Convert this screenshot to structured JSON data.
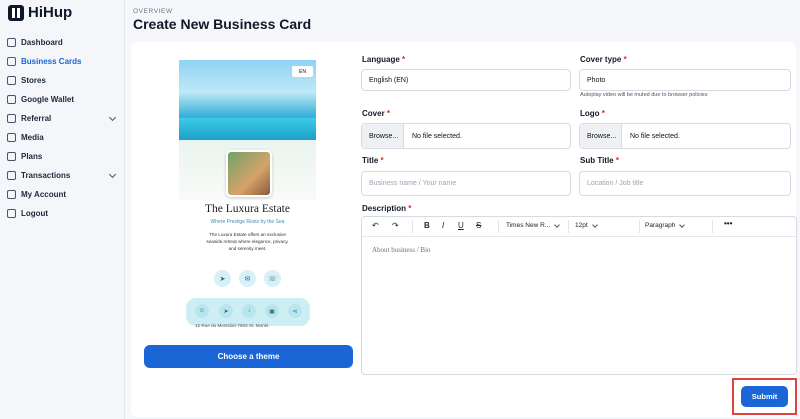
{
  "app": {
    "name": "HiHup"
  },
  "sidebar": {
    "items": [
      {
        "label": "Dashboard",
        "icon": "home-icon"
      },
      {
        "label": "Business Cards",
        "icon": "card-icon",
        "active": true
      },
      {
        "label": "Stores",
        "icon": "store-icon"
      },
      {
        "label": "Google Wallet",
        "icon": "wallet-icon"
      },
      {
        "label": "Referral",
        "icon": "link-icon",
        "expandable": true
      },
      {
        "label": "Media",
        "icon": "media-icon"
      },
      {
        "label": "Plans",
        "icon": "plans-icon"
      },
      {
        "label": "Transactions",
        "icon": "transactions-icon",
        "expandable": true
      },
      {
        "label": "My Account",
        "icon": "user-icon"
      },
      {
        "label": "Logout",
        "icon": "logout-icon"
      }
    ]
  },
  "header": {
    "overview": "OVERVIEW",
    "title": "Create New Business Card"
  },
  "preview": {
    "lang_chip": "EN",
    "title": "The Luxura Estate",
    "subtitle": "Where Prestige Rests by the Sea",
    "description": "The Luxura Estate offers an exclusive seaside retreat where elegance, privacy, and serenity meet.",
    "address": "12 Rue du Montclair 7503 St. Monts",
    "theme_button": "Choose a theme"
  },
  "form": {
    "language": {
      "label": "Language",
      "value": "English (EN)"
    },
    "cover_type": {
      "label": "Cover type",
      "value": "Photo",
      "hint": "Autoplay video will be muted due to browser policies"
    },
    "cover": {
      "label": "Cover",
      "browse": "Browse...",
      "file": "No file selected."
    },
    "logo": {
      "label": "Logo",
      "browse": "Browse...",
      "file": "No file selected."
    },
    "title": {
      "label": "Title",
      "placeholder": "Business name / Your name"
    },
    "subtitle": {
      "label": "Sub Title",
      "placeholder": "Location / Job title"
    },
    "description": {
      "label": "Description",
      "font": "Times New R...",
      "size": "12pt",
      "block": "Paragraph",
      "placeholder": "About business / Bio"
    },
    "required_mark": "*",
    "submit": "Submit"
  },
  "colors": {
    "accent": "#1a66d6",
    "highlight": "#e0443f"
  }
}
